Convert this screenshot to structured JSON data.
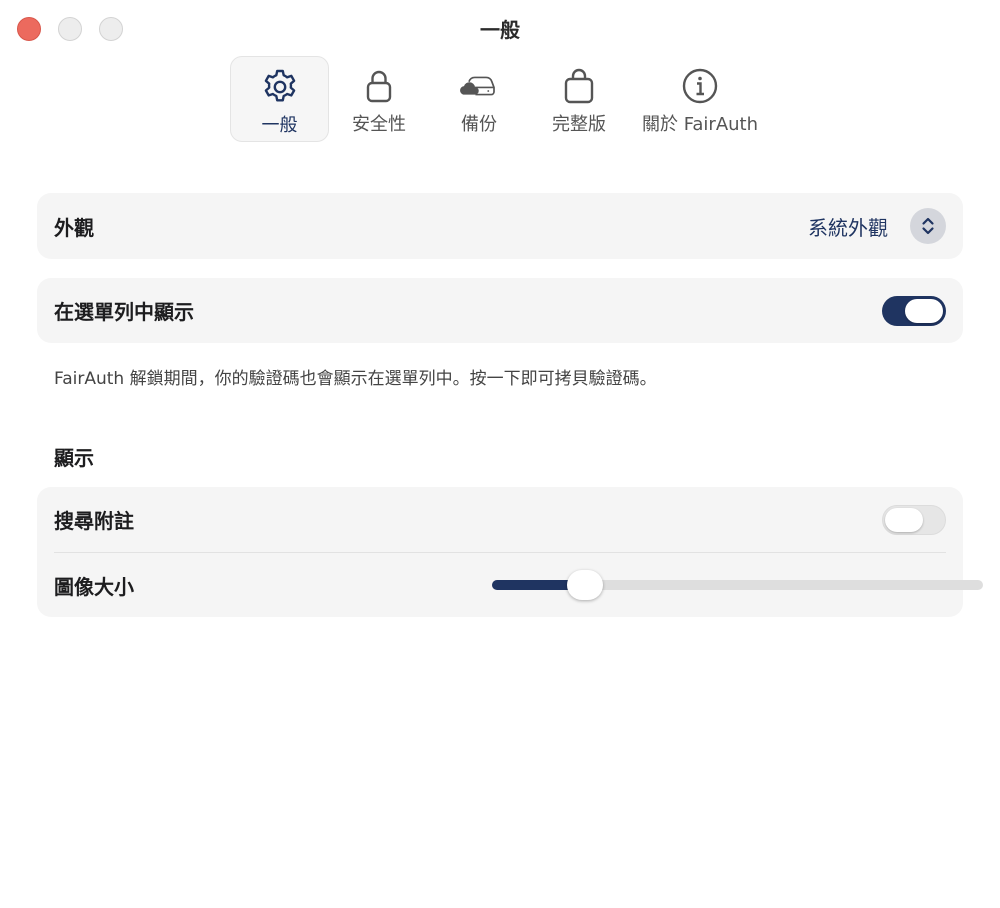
{
  "window": {
    "title": "一般"
  },
  "tabs": [
    {
      "label": "一般",
      "icon": "gear-icon",
      "active": true
    },
    {
      "label": "安全性",
      "icon": "lock-icon",
      "active": false
    },
    {
      "label": "備份",
      "icon": "cloud-drive-icon",
      "active": false
    },
    {
      "label": "完整版",
      "icon": "shopping-bag-icon",
      "active": false
    },
    {
      "label": "關於 FairAuth",
      "icon": "info-icon",
      "active": false
    }
  ],
  "appearance": {
    "label": "外觀",
    "value": "系統外觀"
  },
  "menubar": {
    "label": "在選單列中顯示",
    "enabled": true,
    "helper": "FairAuth 解鎖期間，你的驗證碼也會顯示在選單列中。按一下即可拷貝驗證碼。"
  },
  "display": {
    "title": "顯示",
    "search_notes": {
      "label": "搜尋附註",
      "enabled": false
    },
    "image_size": {
      "label": "圖像大小",
      "value": 0.19
    }
  },
  "colors": {
    "accent": "#1f3461"
  }
}
